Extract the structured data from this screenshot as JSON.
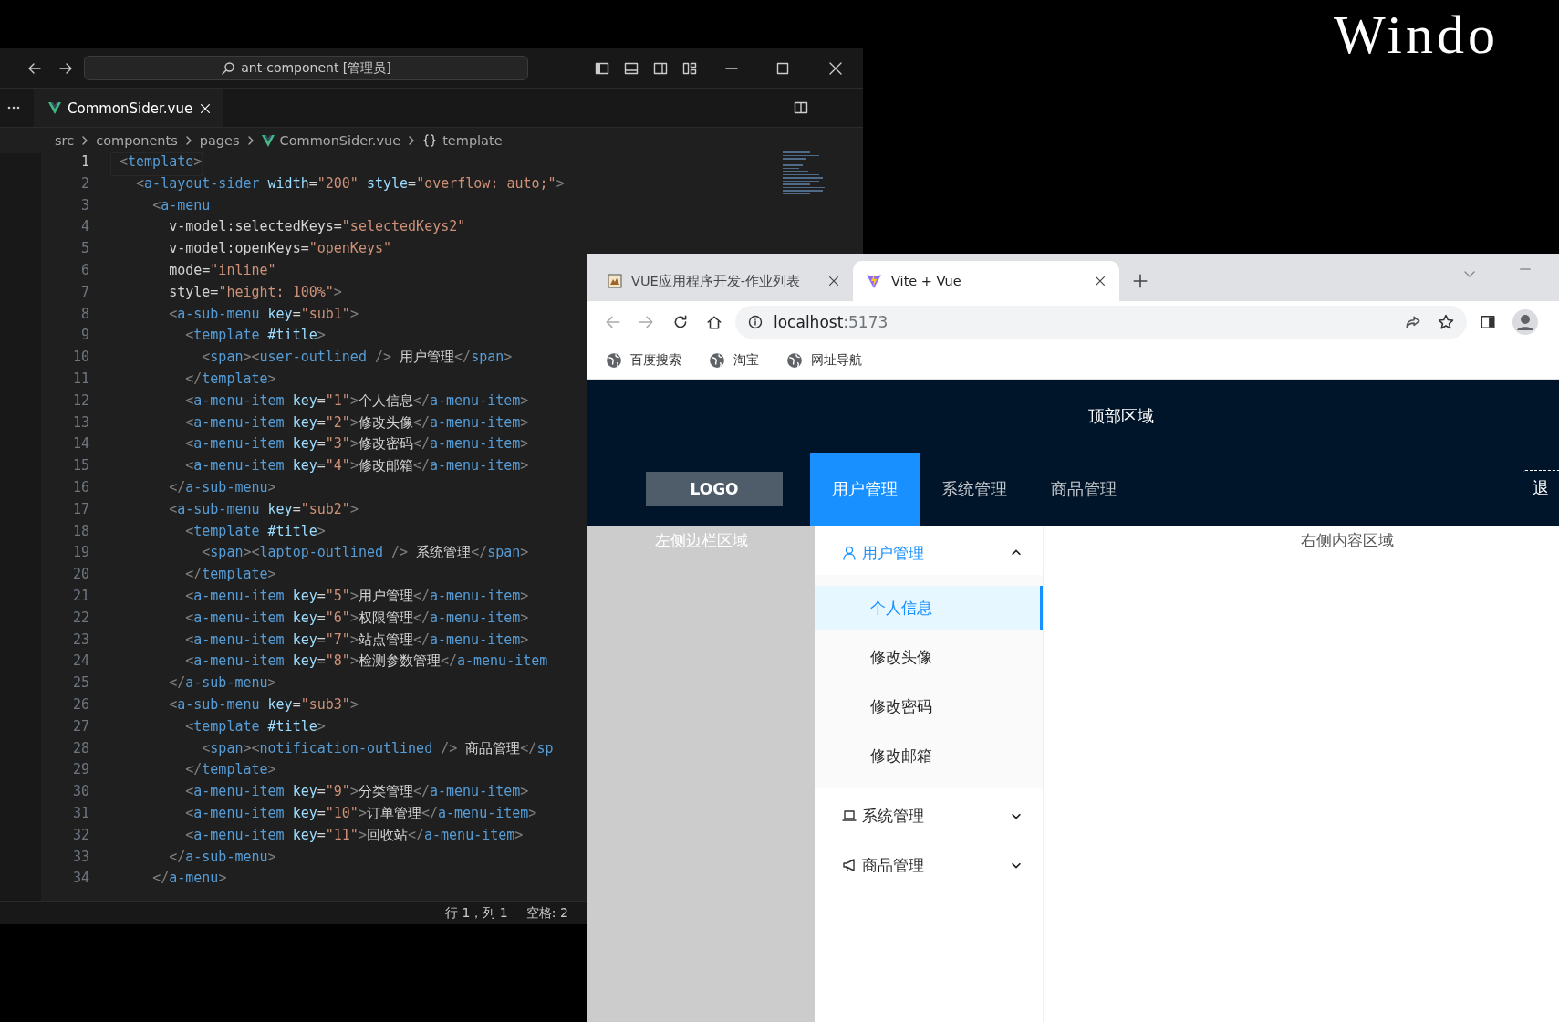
{
  "desktop": {
    "title": "Windo"
  },
  "editor": {
    "command_center": "ant-component [管理员]",
    "tabs": [
      {
        "label": "CommonSider.vue",
        "selected": true
      }
    ],
    "breadcrumbs": [
      {
        "label": "src",
        "kind": "folder"
      },
      {
        "label": "components",
        "kind": "folder"
      },
      {
        "label": "pages",
        "kind": "folder"
      },
      {
        "label": "CommonSider.vue",
        "kind": "vue"
      },
      {
        "label": "template",
        "kind": "braces"
      }
    ],
    "lines": [
      {
        "number": "1",
        "code": "<template>",
        "current": true
      },
      {
        "number": "2",
        "code": "  <a-layout-sider width=\"200\" style=\"overflow: auto;\">",
        "current": false
      },
      {
        "number": "3",
        "code": "    <a-menu",
        "current": false
      },
      {
        "number": "4",
        "code": "      v-model:selectedKeys=\"selectedKeys2\"",
        "current": false
      },
      {
        "number": "5",
        "code": "      v-model:openKeys=\"openKeys\"",
        "current": false
      },
      {
        "number": "6",
        "code": "      mode=\"inline\"",
        "current": false
      },
      {
        "number": "7",
        "code": "      style=\"height: 100%\">",
        "current": false
      },
      {
        "number": "8",
        "code": "      <a-sub-menu key=\"sub1\">",
        "current": false
      },
      {
        "number": "9",
        "code": "        <template #title>",
        "current": false
      },
      {
        "number": "10",
        "code": "          <span><user-outlined /> 用户管理</span>",
        "current": false
      },
      {
        "number": "11",
        "code": "        </template>",
        "current": false
      },
      {
        "number": "12",
        "code": "        <a-menu-item key=\"1\">个人信息</a-menu-item>",
        "current": false
      },
      {
        "number": "13",
        "code": "        <a-menu-item key=\"2\">修改头像</a-menu-item>",
        "current": false
      },
      {
        "number": "14",
        "code": "        <a-menu-item key=\"3\">修改密码</a-menu-item>",
        "current": false
      },
      {
        "number": "15",
        "code": "        <a-menu-item key=\"4\">修改邮箱</a-menu-item>",
        "current": false
      },
      {
        "number": "16",
        "code": "      </a-sub-menu>",
        "current": false
      },
      {
        "number": "17",
        "code": "      <a-sub-menu key=\"sub2\">",
        "current": false
      },
      {
        "number": "18",
        "code": "        <template #title>",
        "current": false
      },
      {
        "number": "19",
        "code": "          <span><laptop-outlined /> 系统管理</span>",
        "current": false
      },
      {
        "number": "20",
        "code": "        </template>",
        "current": false
      },
      {
        "number": "21",
        "code": "        <a-menu-item key=\"5\">用户管理</a-menu-item>",
        "current": false
      },
      {
        "number": "22",
        "code": "        <a-menu-item key=\"6\">权限管理</a-menu-item>",
        "current": false
      },
      {
        "number": "23",
        "code": "        <a-menu-item key=\"7\">站点管理</a-menu-item>",
        "current": false
      },
      {
        "number": "24",
        "code": "        <a-menu-item key=\"8\">检测参数管理</a-menu-item",
        "current": false
      },
      {
        "number": "25",
        "code": "      </a-sub-menu>",
        "current": false
      },
      {
        "number": "26",
        "code": "      <a-sub-menu key=\"sub3\">",
        "current": false
      },
      {
        "number": "27",
        "code": "        <template #title>",
        "current": false
      },
      {
        "number": "28",
        "code": "          <span><notification-outlined /> 商品管理</sp",
        "current": false
      },
      {
        "number": "29",
        "code": "        </template>",
        "current": false
      },
      {
        "number": "30",
        "code": "        <a-menu-item key=\"9\">分类管理</a-menu-item>",
        "current": false
      },
      {
        "number": "31",
        "code": "        <a-menu-item key=\"10\">订单管理</a-menu-item>",
        "current": false
      },
      {
        "number": "32",
        "code": "        <a-menu-item key=\"11\">回收站</a-menu-item>",
        "current": false
      },
      {
        "number": "33",
        "code": "      </a-sub-menu>",
        "current": false
      },
      {
        "number": "34",
        "code": "    </a-menu>",
        "current": false
      }
    ],
    "status_bar": [
      "行 1，列 1",
      "空格: 2"
    ]
  },
  "browser": {
    "tabs": [
      {
        "title": "VUE应用程序开发-作业列表",
        "selected": false,
        "kind": "image"
      },
      {
        "title": "Vite + Vue",
        "selected": true,
        "kind": "vite"
      }
    ],
    "address": {
      "host": "localhost",
      "port": ":5173"
    },
    "bookmarks": [
      "百度搜索",
      "淘宝",
      "网址导航"
    ],
    "page": {
      "header_title": "顶部区域",
      "logo": "LOGO",
      "nav": [
        {
          "label": "用户管理",
          "selected": true
        },
        {
          "label": "系统管理",
          "selected": false
        },
        {
          "label": "商品管理",
          "selected": false
        }
      ],
      "logout": "退",
      "sider_label": "左侧边栏区域",
      "menu": [
        {
          "label": "用户管理",
          "kind": "user",
          "expanded": true,
          "children": [
            {
              "label": "个人信息",
              "selected": true
            },
            {
              "label": "修改头像",
              "selected": false
            },
            {
              "label": "修改密码",
              "selected": false
            },
            {
              "label": "修改邮箱",
              "selected": false
            }
          ]
        },
        {
          "label": "系统管理",
          "kind": "laptop",
          "expanded": false
        },
        {
          "label": "商品管理",
          "kind": "notification",
          "expanded": false
        }
      ],
      "content_label": "右侧内容区域"
    }
  }
}
